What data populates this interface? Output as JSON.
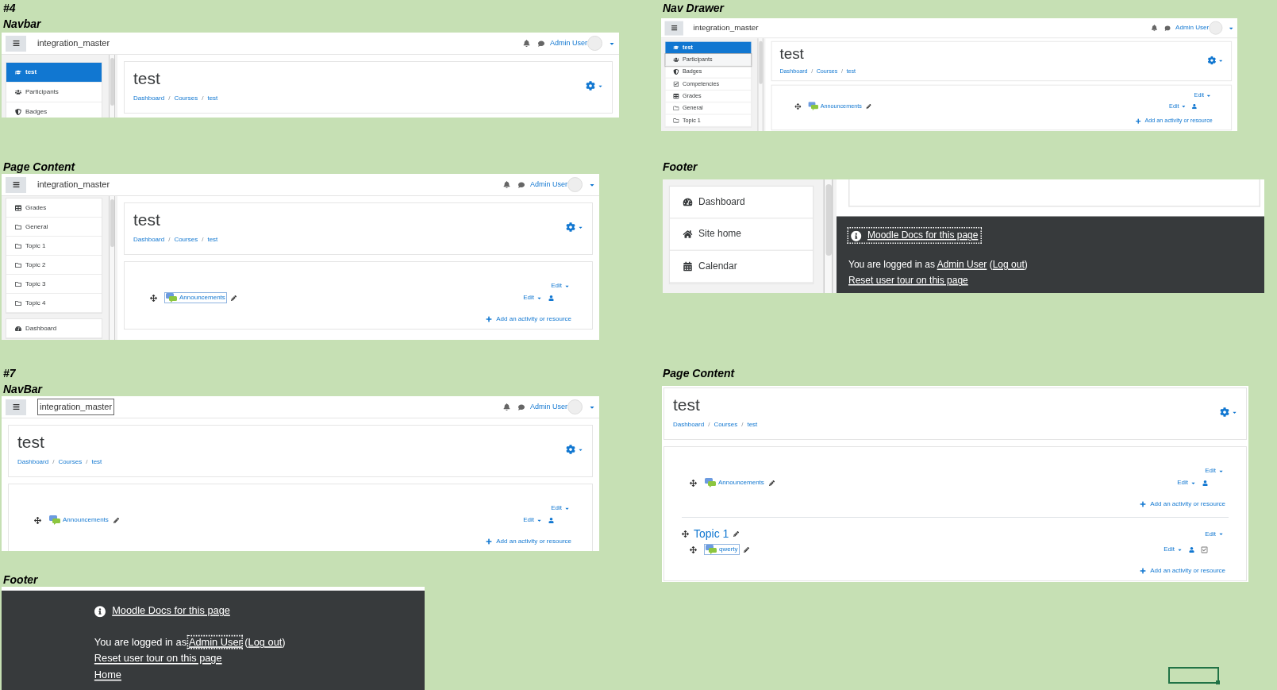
{
  "panels": [
    {
      "captions": [
        "#4",
        "Navbar"
      ],
      "navbar": {
        "site_name": "integration_master",
        "site_name_focused": false,
        "user_name": "Admin User"
      },
      "drawer": {
        "groups": [
          {
            "items": [
              {
                "kind": "course",
                "label": "test",
                "selected": true,
                "focused": false
              },
              {
                "kind": "participants",
                "label": "Participants",
                "selected": false,
                "focused": false
              },
              {
                "kind": "badges",
                "label": "Badges",
                "selected": false,
                "focused": false
              }
            ]
          }
        ]
      },
      "header": {
        "title": "test",
        "breadcrumbs": [
          "Dashboard",
          "Courses",
          "test"
        ],
        "separator": "/"
      }
    },
    {
      "captions": [
        "Nav Drawer"
      ],
      "navbar": {
        "site_name": "integration_master",
        "site_name_focused": false,
        "user_name": "Admin User"
      },
      "drawer": {
        "groups": [
          {
            "items": [
              {
                "kind": "course",
                "label": "test",
                "selected": true,
                "focused": false
              },
              {
                "kind": "participants",
                "label": "Participants",
                "selected": false,
                "focused": true
              },
              {
                "kind": "badges",
                "label": "Badges",
                "selected": false,
                "focused": false
              },
              {
                "kind": "competencies",
                "label": "Competencies",
                "selected": false,
                "focused": false
              },
              {
                "kind": "grades",
                "label": "Grades",
                "selected": false,
                "focused": false
              },
              {
                "kind": "section",
                "label": "General",
                "selected": false,
                "focused": false
              },
              {
                "kind": "section",
                "label": "Topic 1",
                "selected": false,
                "focused": false
              }
            ]
          }
        ]
      },
      "header": {
        "title": "test",
        "breadcrumbs": [
          "Dashboard",
          "Courses",
          "test"
        ],
        "separator": "/"
      },
      "sections": [
        {
          "edit": "Edit",
          "activities": [
            {
              "name": "Announcements",
              "focused": false,
              "edit": "Edit",
              "completion": false
            }
          ],
          "add": "Add an activity or resource"
        }
      ]
    },
    {
      "captions": [
        "Page Content"
      ],
      "navbar": {
        "site_name": "integration_master",
        "site_name_focused": false,
        "user_name": "Admin User"
      },
      "drawer": {
        "groups": [
          {
            "items": [
              {
                "kind": "grades",
                "label": "Grades",
                "selected": false,
                "focused": false
              },
              {
                "kind": "section",
                "label": "General",
                "selected": false,
                "focused": false
              },
              {
                "kind": "section",
                "label": "Topic 1",
                "selected": false,
                "focused": false
              },
              {
                "kind": "section",
                "label": "Topic 2",
                "selected": false,
                "focused": false
              },
              {
                "kind": "section",
                "label": "Topic 3",
                "selected": false,
                "focused": false
              },
              {
                "kind": "section",
                "label": "Topic 4",
                "selected": false,
                "focused": false
              }
            ]
          },
          {
            "items": [
              {
                "kind": "dashboard",
                "label": "Dashboard",
                "selected": false,
                "focused": false
              }
            ]
          }
        ]
      },
      "header": {
        "title": "test",
        "breadcrumbs": [
          "Dashboard",
          "Courses",
          "test"
        ],
        "separator": "/"
      },
      "sections": [
        {
          "edit": "Edit",
          "activities": [
            {
              "name": "Announcements",
              "focused": true,
              "edit": "Edit",
              "completion": false
            }
          ],
          "add": "Add an activity or resource"
        }
      ]
    },
    {
      "captions": [
        "Footer"
      ],
      "drawer": {
        "groups": [
          {
            "items": [
              {
                "kind": "dashboard",
                "label": "Dashboard",
                "selected": false,
                "focused": false
              },
              {
                "kind": "home",
                "label": "Site home",
                "selected": false,
                "focused": false
              },
              {
                "kind": "calendar",
                "label": "Calendar",
                "selected": false,
                "focused": false
              }
            ]
          }
        ]
      },
      "footer": {
        "docs_link": "Moodle Docs for this page",
        "docs_focused": true,
        "before": "You are logged in as ",
        "user": "Admin User",
        "user_focused": false,
        "between": " (",
        "logout": "Log out",
        "after": ")",
        "links": [
          "Reset user tour on this page"
        ]
      }
    },
    {
      "captions": [
        "#7",
        "NavBar"
      ],
      "navbar": {
        "site_name": "integration_master",
        "site_name_focused": true,
        "user_name": "Admin User"
      },
      "header": {
        "title": "test",
        "breadcrumbs": [
          "Dashboard",
          "Courses",
          "test"
        ],
        "separator": "/"
      },
      "sections": [
        {
          "edit": "Edit",
          "activities": [
            {
              "name": "Announcements",
              "focused": false,
              "edit": "Edit",
              "completion": false
            }
          ],
          "add": "Add an activity or resource"
        }
      ]
    },
    {
      "captions": [
        "Page Content"
      ],
      "header": {
        "title": "test",
        "breadcrumbs": [
          "Dashboard",
          "Courses",
          "test"
        ],
        "separator": "/"
      },
      "sections": [
        {
          "edit": "Edit",
          "activities": [
            {
              "name": "Announcements",
              "focused": false,
              "edit": "Edit",
              "completion": false
            }
          ],
          "add": "Add an activity or resource"
        },
        {
          "title": "Topic 1",
          "edit": "Edit",
          "activities": [
            {
              "name": "qwerty",
              "focused": true,
              "edit": "Edit",
              "completion": true
            }
          ],
          "add": "Add an activity or resource"
        }
      ]
    },
    {
      "captions": [
        "Footer"
      ],
      "footer": {
        "docs_link": "Moodle Docs for this page",
        "docs_focused": false,
        "before": "You are logged in as ",
        "user": "Admin User",
        "user_focused": true,
        "between": " (",
        "logout": "Log out",
        "after": ")",
        "links": [
          "Reset user tour on this page",
          "Home"
        ]
      }
    }
  ]
}
